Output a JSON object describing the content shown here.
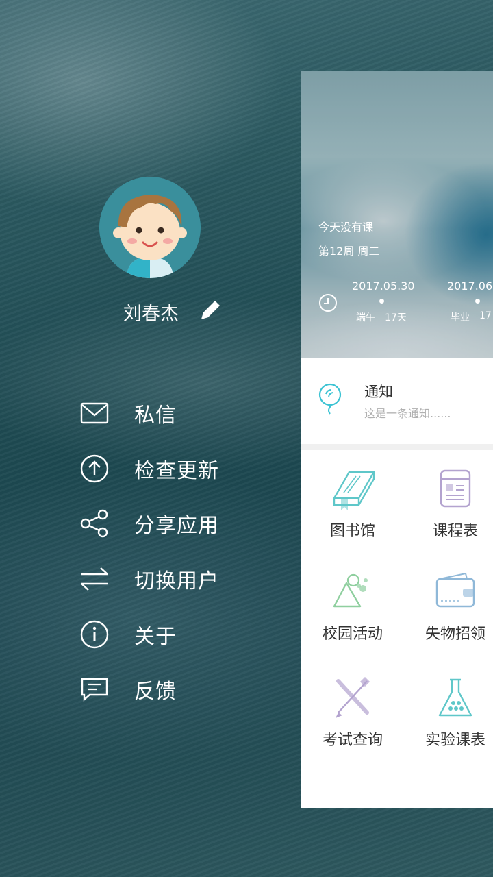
{
  "drawer": {
    "username": "刘春杰",
    "menu": [
      {
        "label": "私信",
        "icon": "mail-icon"
      },
      {
        "label": "检查更新",
        "icon": "upload-icon"
      },
      {
        "label": "分享应用",
        "icon": "share-icon"
      },
      {
        "label": "切换用户",
        "icon": "switch-icon"
      },
      {
        "label": "关于",
        "icon": "info-icon"
      },
      {
        "label": "反馈",
        "icon": "message-icon"
      }
    ]
  },
  "main": {
    "hero": {
      "no_class": "今天没有课",
      "week": "第12周 周二",
      "timeline": [
        {
          "date": "2017.05.30",
          "event": "端午",
          "days": "17天"
        },
        {
          "date": "2017.06.",
          "event": "毕业",
          "days": "17"
        }
      ]
    },
    "notice": {
      "title": "通知",
      "desc": "这是一条通知......"
    },
    "grid": [
      {
        "label": "图书馆",
        "icon": "book-icon"
      },
      {
        "label": "课程表",
        "icon": "schedule-icon"
      },
      {
        "label": "校园活动",
        "icon": "activity-icon"
      },
      {
        "label": "失物招领",
        "icon": "wallet-icon"
      },
      {
        "label": "考试查询",
        "icon": "exam-icon"
      },
      {
        "label": "实验课表",
        "icon": "flask-icon"
      }
    ]
  },
  "colors": {
    "accent": "#3cc3d3",
    "panel": "#ffffff",
    "text": "#333333",
    "muted": "#b0b0b0"
  }
}
